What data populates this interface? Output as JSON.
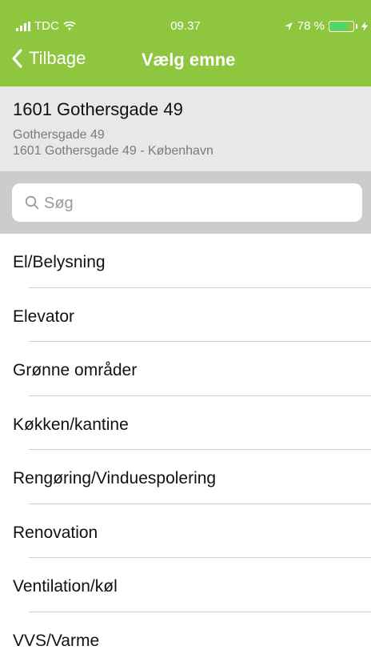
{
  "status_bar": {
    "carrier": "TDC",
    "time": "09.37",
    "battery": "78 %",
    "battery_level": 0.78
  },
  "nav": {
    "back_label": "Tilbage",
    "title": "Vælg emne"
  },
  "location": {
    "name": "1601 Gothersgade 49",
    "street": "Gothersgade 49",
    "detail": "1601 Gothersgade 49 - København"
  },
  "search": {
    "placeholder": "Søg"
  },
  "topics": [
    {
      "label": "El/Belysning"
    },
    {
      "label": "Elevator"
    },
    {
      "label": "Grønne områder"
    },
    {
      "label": "Køkken/kantine"
    },
    {
      "label": "Rengøring/Vinduespolering"
    },
    {
      "label": "Renovation"
    },
    {
      "label": "Ventilation/køl"
    },
    {
      "label": "VVS/Varme"
    }
  ],
  "colors": {
    "accent": "#8ec63f",
    "header_bg": "#e8e8e8",
    "search_bg": "#cccccc"
  }
}
